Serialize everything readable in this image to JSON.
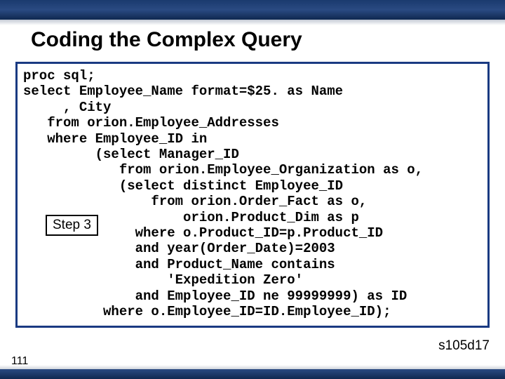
{
  "title": "Coding the Complex Query",
  "step_label": "Step 3",
  "page_number": "111",
  "slide_id": "s105d17",
  "code": "proc sql;\nselect Employee_Name format=$25. as Name\n     , City\n   from orion.Employee_Addresses\n   where Employee_ID in\n         (select Manager_ID\n            from orion.Employee_Organization as o,\n            (select distinct Employee_ID\n                from orion.Order_Fact as o,\n                    orion.Product_Dim as p\n              where o.Product_ID=p.Product_ID\n              and year(Order_Date)=2003\n              and Product_Name contains\n                  'Expedition Zero'\n              and Employee_ID ne 99999999) as ID\n          where o.Employee_ID=ID.Employee_ID);"
}
